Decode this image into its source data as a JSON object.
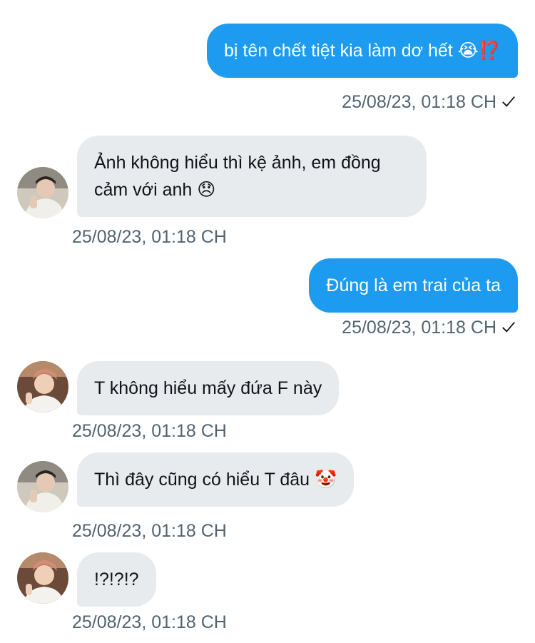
{
  "messages": [
    {
      "direction": "outgoing",
      "text": "bị tên chết tiệt kia làm dơ hết 😭⁉️",
      "timestamp": "25/08/23, 01:18 CH",
      "sent_icon": "checkmark-icon"
    },
    {
      "direction": "incoming",
      "text": "Ảnh không hiểu thì kệ ảnh, em đồng cảm với anh 😞",
      "timestamp": "25/08/23, 01:18 CH",
      "avatar": "avatar-1"
    },
    {
      "direction": "outgoing",
      "text": "Đúng là em trai của ta",
      "timestamp": "25/08/23, 01:18 CH",
      "sent_icon": "checkmark-icon"
    },
    {
      "direction": "incoming",
      "text": "T không hiểu mấy đứa F này",
      "timestamp": "25/08/23, 01:18 CH",
      "avatar": "avatar-2"
    },
    {
      "direction": "incoming",
      "text": "Thì đây cũng có hiểu T đâu 🤡",
      "timestamp": "25/08/23, 01:18 CH",
      "avatar": "avatar-1"
    },
    {
      "direction": "incoming",
      "text": "!?!?!?",
      "timestamp": "25/08/23, 01:18 CH",
      "avatar": "avatar-2"
    }
  ],
  "colors": {
    "outgoing_bubble": "#1d9bf0",
    "incoming_bubble": "#e8ebee",
    "timestamp": "#536471",
    "incoming_text": "#0f1419"
  }
}
